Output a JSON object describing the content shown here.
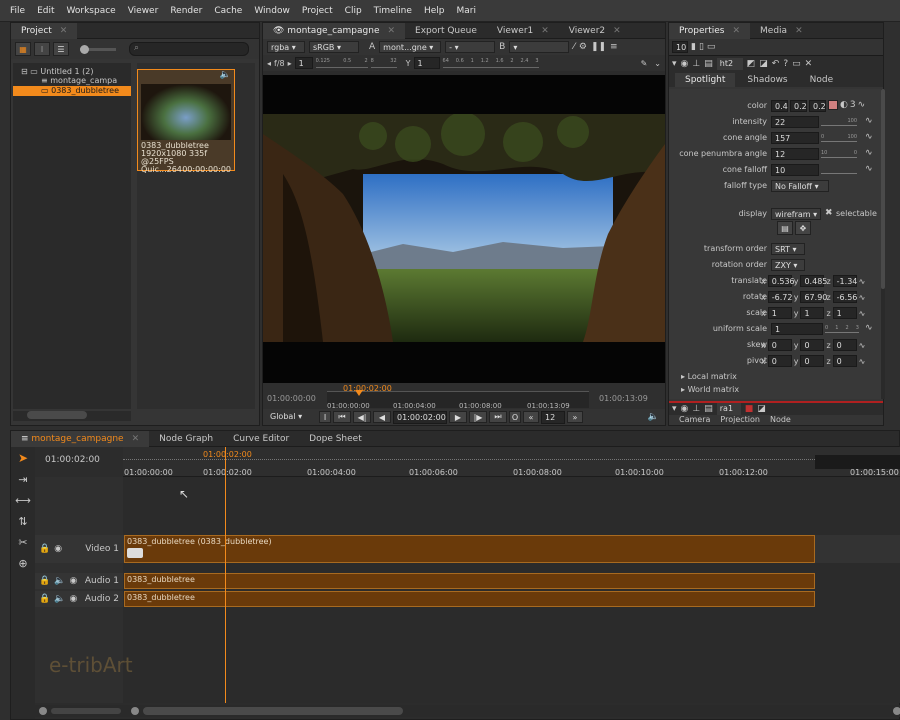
{
  "menu": [
    "File",
    "Edit",
    "Workspace",
    "Viewer",
    "Render",
    "Cache",
    "Window",
    "Project",
    "Clip",
    "Timeline",
    "Help",
    "Mari"
  ],
  "project": {
    "tab": "Project",
    "tree_root": "Untitled 1 (2)",
    "tree_item1": "montage_campa",
    "tree_item2": "0383_dubbletree",
    "thumb_name": "0383_dubbletree",
    "thumb_meta": "1920x1080 335f @25FPS",
    "thumb_codec": "Quic...264",
    "thumb_tc": "00:00:00:00"
  },
  "viewer": {
    "tabs": [
      "montage_campagne",
      "Export Queue",
      "Viewer1",
      "Viewer2"
    ],
    "channels": "rgba",
    "colorspace": "sRGB",
    "a_label": "A",
    "a_input": "mont...gne",
    "dash": "-",
    "b_label": "B",
    "fstop": "f/8",
    "gain": "1",
    "y_label": "Y",
    "gamma": "1",
    "tc_top": "01:00:02:00",
    "tc_start": "01:00:00:00",
    "tc_end": "01:00:13:09",
    "ruler": [
      "01:00:00:00",
      "01:00:04:00",
      "01:00:08:00",
      "01:00:13:09"
    ],
    "global": "Global",
    "current_tc": "01:00:02:00",
    "step": "12",
    "frame_I": "I",
    "frame_O": "O",
    "gain_ticks": [
      "0.125",
      "0.5",
      "2",
      "8",
      "32",
      "64",
      "0.6",
      "1",
      "1.2",
      "1.6",
      "2",
      "2.4",
      "3"
    ]
  },
  "properties": {
    "tabs": [
      "Properties",
      "Media"
    ],
    "max_panels": "10",
    "node_name": "ht2",
    "sub_tabs": [
      "Spotlight",
      "Shadows",
      "Node"
    ],
    "color_label": "color",
    "color_vals": [
      "0.4",
      "0.2",
      "0.2"
    ],
    "color_num": "3",
    "intensity_label": "intensity",
    "intensity": "22",
    "cone_angle_label": "cone angle",
    "cone_angle": "157",
    "penumbra_label": "cone penumbra angle",
    "penumbra": "12",
    "falloff_label": "cone falloff",
    "falloff": "10",
    "falloff_type_label": "falloff type",
    "falloff_type": "No Falloff",
    "display_label": "display",
    "display": "wirefram",
    "selectable": "selectable",
    "transform_order_label": "transform order",
    "transform_order": "SRT",
    "rotation_order_label": "rotation order",
    "rotation_order": "ZXY",
    "translate_label": "translate",
    "translate": [
      "0.536",
      "0.485",
      "-1.34"
    ],
    "rotate_label": "rotate",
    "rotate": [
      "-6.72",
      "67.90",
      "-6.56"
    ],
    "scale_label": "scale",
    "scale": [
      "1",
      "1",
      "1"
    ],
    "uniform_scale_label": "uniform scale",
    "uniform_scale": "1",
    "skew_label": "skew",
    "skew": [
      "0",
      "0",
      "0"
    ],
    "pivot_label": "pivot",
    "pivot": [
      "0",
      "0",
      "0"
    ],
    "local_matrix": "Local matrix",
    "world_matrix": "World matrix",
    "x": "x",
    "y": "y",
    "z": "z",
    "scale_ticks": [
      "0",
      "1",
      "2",
      "3"
    ],
    "intensity_ticks": [
      "100"
    ],
    "angle_ticks": [
      "0",
      "100"
    ],
    "penumbra_ticks": [
      "10",
      "0"
    ],
    "second_node": "ra1",
    "second_tabs": [
      "Camera",
      "Projection",
      "Node"
    ]
  },
  "timeline": {
    "tabs": [
      "montage_campagne",
      "Node Graph",
      "Curve Editor",
      "Dope Sheet"
    ],
    "current_tc": "01:00:02:00",
    "playhead_tc": "01:00:02:00",
    "ruler": [
      "01:00:00:00",
      "01:00:02:00",
      "01:00:04:00",
      "01:00:06:00",
      "01:00:08:00",
      "01:00:10:00",
      "01:00:12:00",
      "01:00:15:00"
    ],
    "tracks": [
      {
        "name": "Video 1",
        "clip": "0383_dubbletree (0383_dubbletree)"
      },
      {
        "name": "Audio 1",
        "clip": "0383_dubbletree"
      },
      {
        "name": "Audio 2",
        "clip": "0383_dubbletree"
      }
    ]
  },
  "watermark": "e-tribArt",
  "colors": {
    "accent": "#f28a1c",
    "clip_fill": "#6a3a0a",
    "clip_border": "#a86a20"
  }
}
